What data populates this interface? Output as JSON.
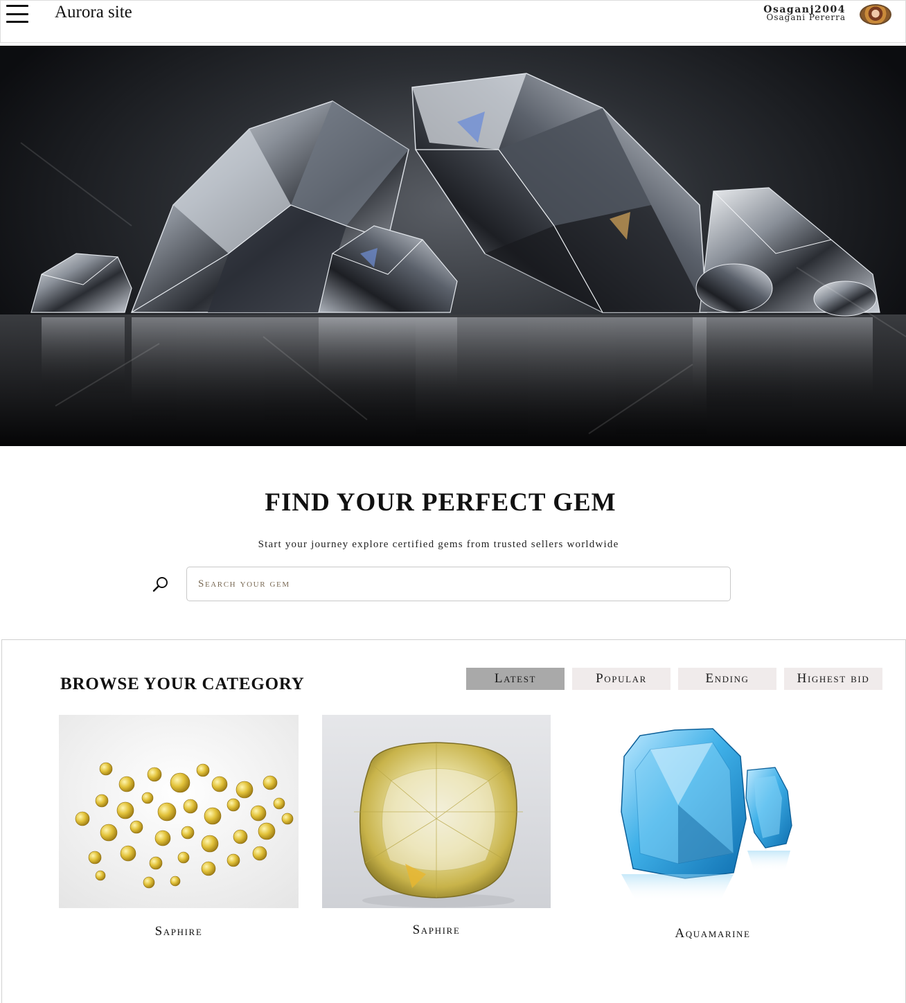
{
  "header": {
    "site_title": "Aurora site",
    "user_handle": "Osaganj2004",
    "user_fullname": "Osagani Pererra"
  },
  "hero": {
    "image": "diamonds-on-dark-reflective-surface"
  },
  "search": {
    "title": "FIND YOUR PERFECT GEM",
    "subtitle": "Start your journey explore certified gems from trusted sellers worldwide",
    "placeholder": "Search your gem",
    "value": ""
  },
  "browse": {
    "title": "BROWSE YOUR CATEGORY",
    "tabs": [
      {
        "label": "Latest",
        "active": true
      },
      {
        "label": "Popular",
        "active": false
      },
      {
        "label": "Ending",
        "active": false
      },
      {
        "label": "Highest bid",
        "active": false
      }
    ],
    "items": [
      {
        "name": "Saphire",
        "image": "scattered-yellow-sapphires"
      },
      {
        "name": "Saphire",
        "image": "cushion-cut-yellow-sapphire"
      },
      {
        "name": "Aquamarine",
        "image": "emerald-cut-blue-aquamarines"
      }
    ]
  },
  "colors": {
    "active_tab": "#a9a9a9",
    "inactive_tab": "#f0ebeb",
    "hero_background": "#1c1e22",
    "aquamarine": "#3fb0e8",
    "sapphire_yellow": "#e2c23a"
  }
}
